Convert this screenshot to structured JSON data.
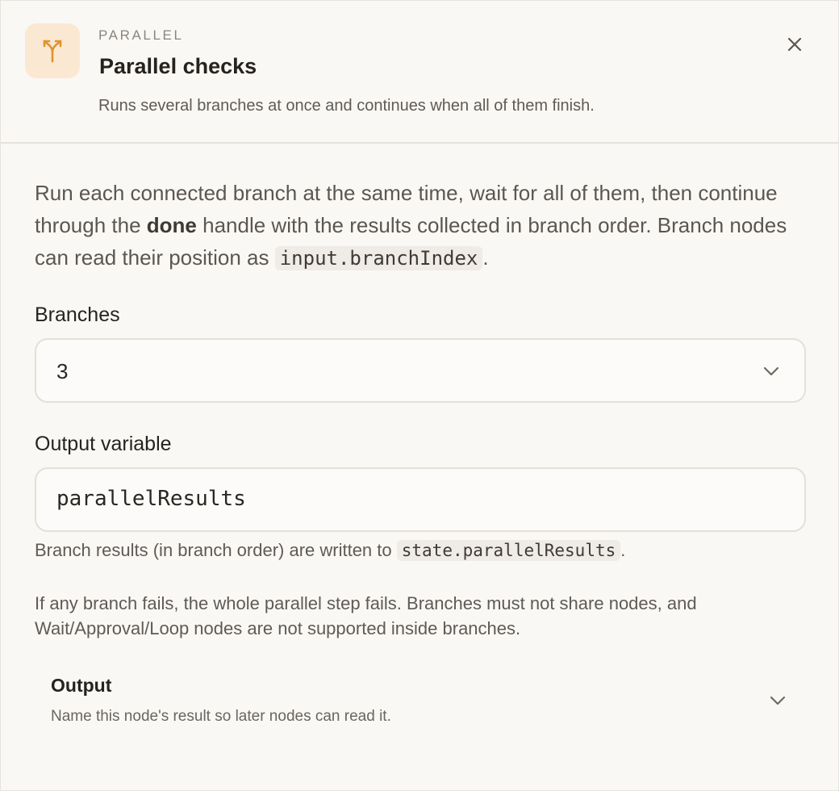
{
  "header": {
    "eyebrow": "PARALLEL",
    "title": "Parallel checks",
    "subtitle": "Runs several branches at once and continues when all of them finish.",
    "icon": "split-branch-icon",
    "accent_color": "#e0932e"
  },
  "intro": {
    "part1": "Run each connected branch at the same time, wait for all of them, then continue through the ",
    "bold": "done",
    "part2": " handle with the results collected in branch order. Branch nodes can read their position as ",
    "code": "input.branchIndex",
    "part3": "."
  },
  "branches": {
    "label": "Branches",
    "value": "3"
  },
  "output_variable": {
    "label": "Output variable",
    "value": "parallelResults",
    "hint_prefix": "Branch results (in branch order) are written to ",
    "hint_code": "state.parallelResults",
    "hint_suffix": "."
  },
  "note": "If any branch fails, the whole parallel step fails. Branches must not share nodes, and Wait/Approval/Loop nodes are not supported inside branches.",
  "output_section": {
    "title": "Output",
    "description": "Name this node's result so later nodes can read it."
  }
}
